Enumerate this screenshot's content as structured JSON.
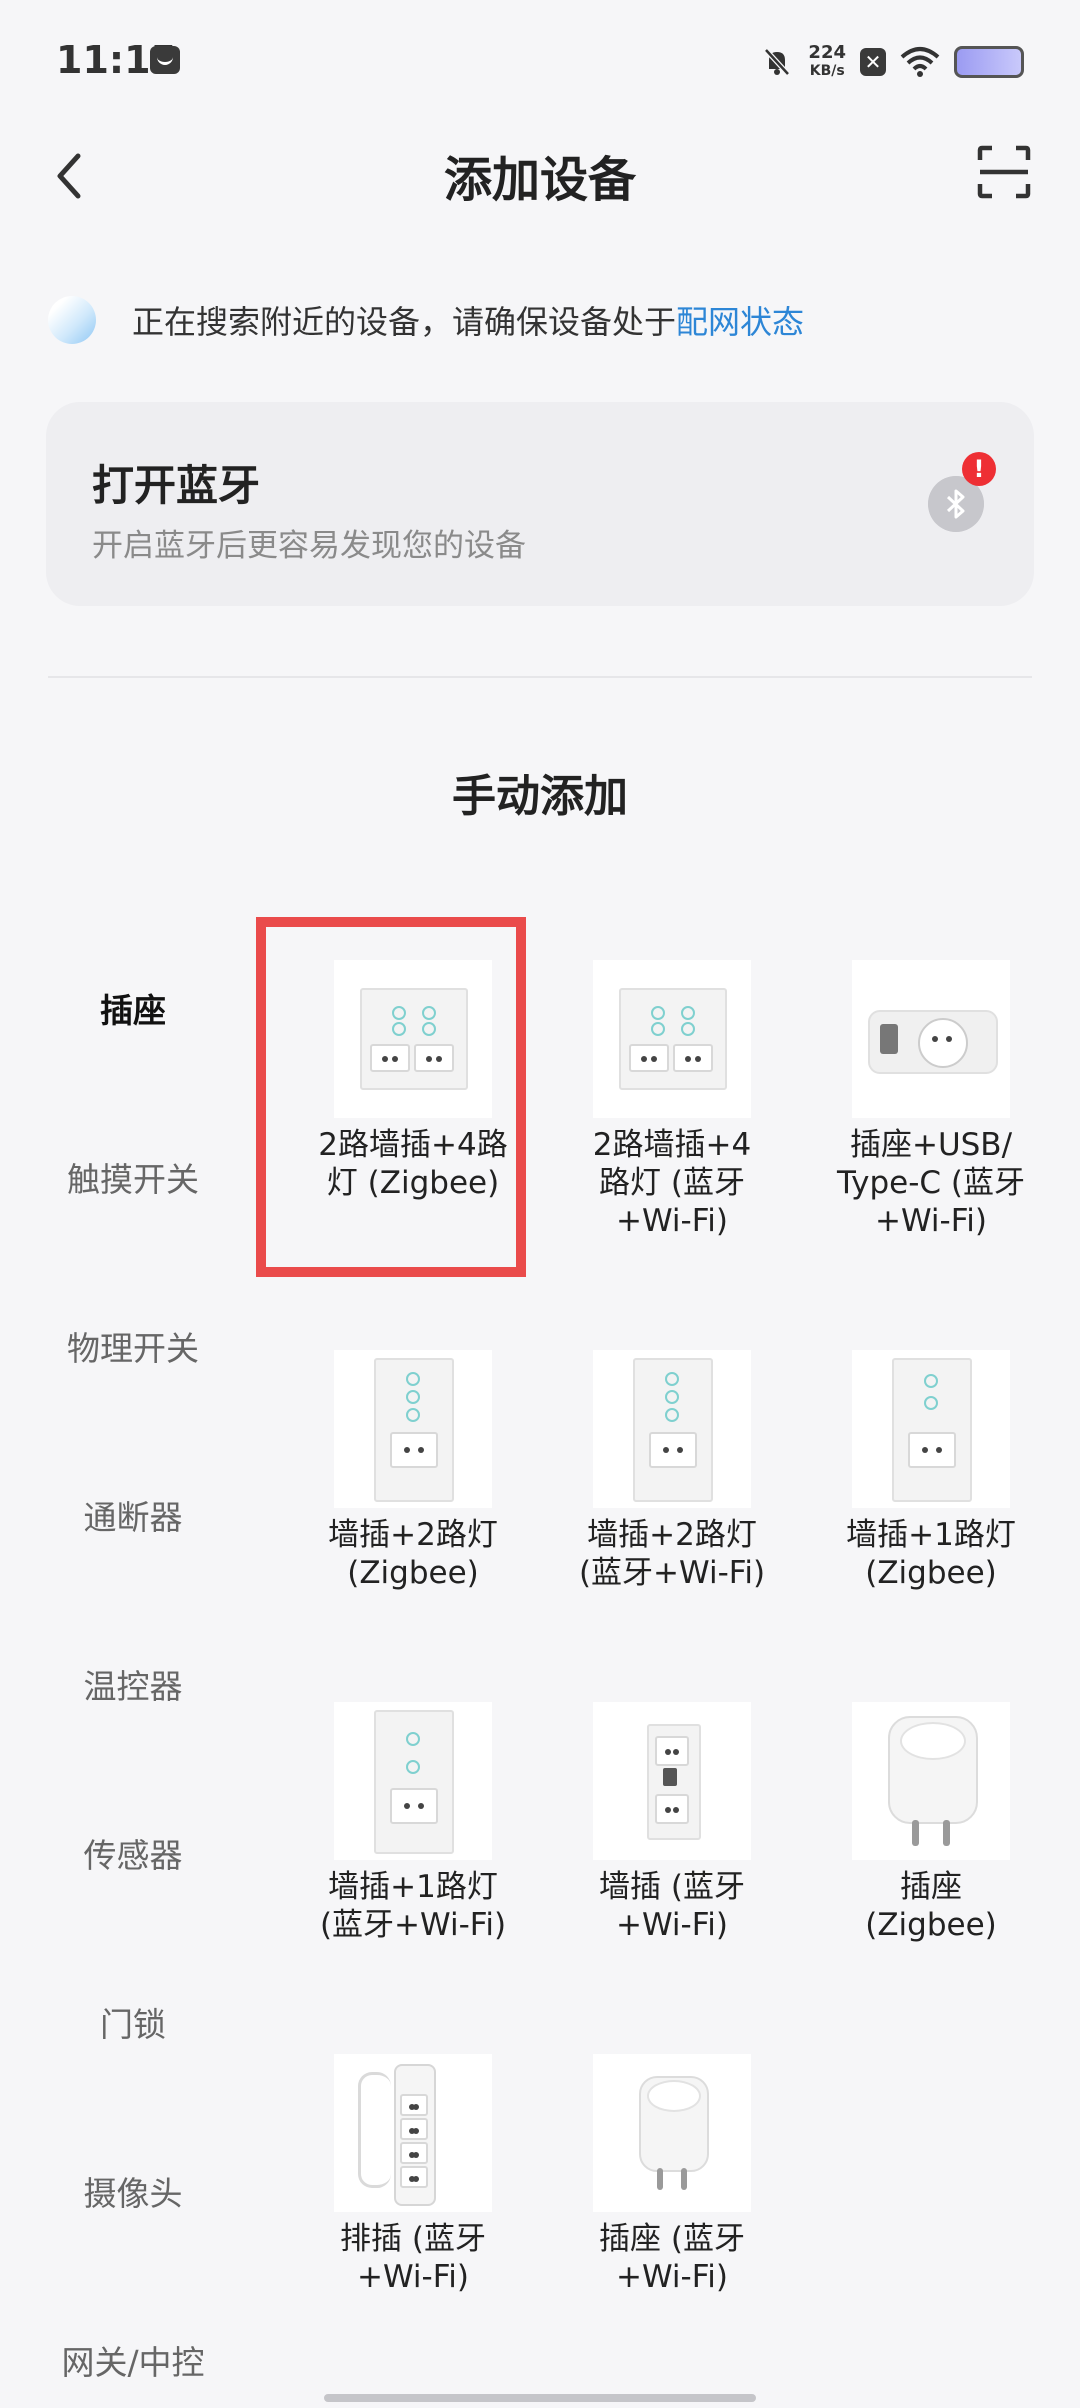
{
  "status_bar": {
    "time": "11:15",
    "net_speed_value": "224",
    "net_speed_unit": "KB/s"
  },
  "header": {
    "title": "添加设备"
  },
  "search": {
    "text": "正在搜索附近的设备，请确保设备处于",
    "link": "配网状态"
  },
  "bluetooth_card": {
    "title": "打开蓝牙",
    "subtitle": "开启蓝牙后更容易发现您的设备",
    "alert": "!"
  },
  "manual": {
    "title": "手动添加",
    "categories": [
      {
        "label": "插座",
        "active": true
      },
      {
        "label": "触摸开关",
        "active": false
      },
      {
        "label": "物理开关",
        "active": false
      },
      {
        "label": "通断器",
        "active": false
      },
      {
        "label": "温控器",
        "active": false
      },
      {
        "label": "传感器",
        "active": false
      },
      {
        "label": "门锁",
        "active": false
      },
      {
        "label": "摄像头",
        "active": false
      },
      {
        "label": "网关/中控",
        "active": false
      }
    ],
    "devices": [
      {
        "label": "2路墙插+4路\n灯 (Zigbee)",
        "icon": "double-socket-4-touch-panel"
      },
      {
        "label": "2路墙插+4\n路灯 (蓝牙\n+Wi-Fi)",
        "icon": "double-socket-4-touch-panel"
      },
      {
        "label": "插座+USB/\nType-C (蓝牙\n+Wi-Fi)",
        "icon": "socket-usb-module"
      },
      {
        "label": "墙插+2路灯\n(Zigbee)",
        "icon": "socket-2-touch-panel"
      },
      {
        "label": "墙插+2路灯\n(蓝牙+Wi-Fi)",
        "icon": "socket-2-touch-panel"
      },
      {
        "label": "墙插+1路灯\n(Zigbee)",
        "icon": "socket-1-touch-panel"
      },
      {
        "label": "墙插+1路灯\n(蓝牙+Wi-Fi)",
        "icon": "socket-1-touch-panel"
      },
      {
        "label": "墙插 (蓝牙\n+Wi-Fi)",
        "icon": "wall-socket-usb"
      },
      {
        "label": "插座\n(Zigbee)",
        "icon": "plug-adapter"
      },
      {
        "label": "排插 (蓝牙\n+Wi-Fi)",
        "icon": "power-strip"
      },
      {
        "label": "插座 (蓝牙\n+Wi-Fi)",
        "icon": "plug-adapter"
      }
    ]
  },
  "colors": {
    "accent_link": "#2d86d6",
    "highlight": "#ea4b4b",
    "alert": "#ee2f34"
  }
}
